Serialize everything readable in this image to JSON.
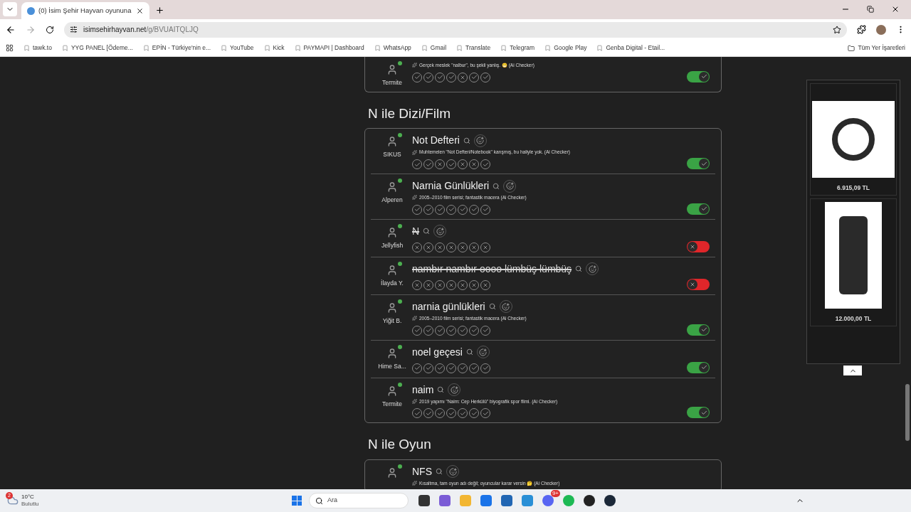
{
  "browser": {
    "tab_title": "(0) İsim Şehir Hayvan oyununa",
    "url_host": "isimsehirhayvan.net",
    "url_path": "/g/BVUAITQLJQ",
    "bookmarks": [
      "tawk.to",
      "YYG PANEL [Ödeme...",
      "EPİN - Türkiye'nin e...",
      "YouTube",
      "Kick",
      "PAYMAPI | Dashboard",
      "WhatsApp",
      "Gmail",
      "Translate",
      "Telegram",
      "Google Play",
      "Genba Digital - Etail..."
    ],
    "all_bookmarks": "Tüm Yer İşaretleri"
  },
  "sections": [
    {
      "cut_top": true,
      "answers": [
        {
          "user": "Termite",
          "online": true,
          "note": "Gerçek meslek \"nalbur\", bu şekli yanlış. 😁 (Ai Checker)",
          "votes": [
            true,
            true,
            true,
            true,
            false,
            true,
            true
          ],
          "accepted": true
        }
      ]
    },
    {
      "title": "N ile Dizi/Film",
      "cut_top": false,
      "answers": [
        {
          "user": "SIKUS",
          "online": true,
          "answer": "Not Defteri",
          "struck": false,
          "note": "Muhtemelen \"Not Defteri/Notebook\" karışmış, bu haliyle yok. (Ai Checker)",
          "votes": [
            true,
            true,
            false,
            true,
            false,
            false,
            true
          ],
          "accepted": true
        },
        {
          "user": "Alperen",
          "online": true,
          "answer": "Narnia Günlükleri",
          "struck": false,
          "note": "2005–2010 film serisi; fantastik macera (Ai Checker)",
          "votes": [
            true,
            true,
            true,
            true,
            true,
            true,
            true
          ],
          "accepted": true
        },
        {
          "user": "Jellyfish",
          "online": true,
          "answer": "N",
          "struck": true,
          "votes": [
            false,
            false,
            false,
            false,
            false,
            false,
            false
          ],
          "accepted": false
        },
        {
          "user": "İlayda Y.",
          "online": true,
          "answer": "nambır nambır oooo lümbüş lümbüş",
          "struck": true,
          "votes": [
            false,
            false,
            false,
            false,
            false,
            false,
            false
          ],
          "accepted": false
        },
        {
          "user": "Yiğit B.",
          "online": true,
          "answer": "narnia günlükleri",
          "struck": false,
          "note": "2005–2010 film serisi; fantastik macera (Ai Checker)",
          "votes": [
            true,
            true,
            true,
            true,
            true,
            true,
            true
          ],
          "accepted": true
        },
        {
          "user": "Hime Sa...",
          "online": true,
          "answer": "noel geçesi",
          "struck": false,
          "votes": [
            true,
            true,
            true,
            true,
            true,
            true,
            true
          ],
          "accepted": true
        },
        {
          "user": "Termite",
          "online": true,
          "answer": "naim",
          "struck": false,
          "note": "2019 yapımı \"Naim: Cep Herkülü\" biyografik spor filmi. (Ai Checker)",
          "votes": [
            true,
            true,
            true,
            true,
            true,
            true,
            true
          ],
          "accepted": true
        }
      ]
    },
    {
      "title": "N ile Oyun",
      "cut_top": false,
      "answers": [
        {
          "online": true,
          "answer": "NFS",
          "struck": false,
          "note": "Kısaltma, tam oyun adı değil; oyuncular karar versin 🤔 (Ai Checker)"
        }
      ]
    }
  ],
  "ads": [
    {
      "price": "6.915,09 TL",
      "kind": "headset"
    },
    {
      "price": "12.000,00 TL",
      "kind": "chair"
    }
  ],
  "taskbar": {
    "temperature": "10°C",
    "weather": "Bulutlu",
    "weather_badge": "2",
    "search": "Ara",
    "discord_badge": "9+"
  }
}
